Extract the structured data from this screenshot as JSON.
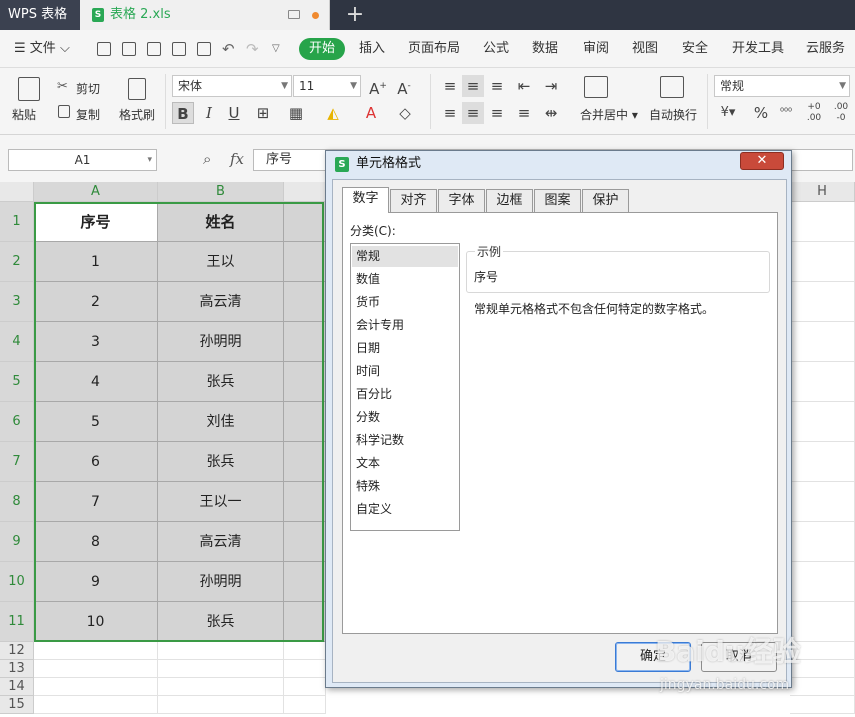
{
  "app": {
    "title": "WPS 表格",
    "doc_tab": "表格 2.xls",
    "xl_glyph": "S",
    "new_tab": "+"
  },
  "menu": {
    "file": "文件",
    "items": [
      "开始",
      "插入",
      "页面布局",
      "公式",
      "数据",
      "审阅",
      "视图",
      "安全",
      "开发工具",
      "云服务"
    ]
  },
  "ribbon": {
    "paste": "粘贴",
    "cut": "剪切",
    "copy": "复制",
    "format_painter": "格式刷",
    "font": "宋体",
    "size": "11",
    "bold": "B",
    "italic": "I",
    "underline": "U",
    "merge_center": "合并居中",
    "wrap_text": "自动换行",
    "number_format": "常规",
    "percent": "%"
  },
  "formula_bar": {
    "name_box": "A1",
    "fx": "fx",
    "content": "序号"
  },
  "grid": {
    "columns": [
      "A",
      "B",
      "H"
    ],
    "header_row": [
      "序号",
      "姓名"
    ],
    "rows": [
      [
        "1",
        "王以"
      ],
      [
        "2",
        "高云清"
      ],
      [
        "3",
        "孙明明"
      ],
      [
        "4",
        "张兵"
      ],
      [
        "5",
        "刘佳"
      ],
      [
        "6",
        "张兵"
      ],
      [
        "7",
        "王以一"
      ],
      [
        "8",
        "高云清"
      ],
      [
        "9",
        "孙明明"
      ],
      [
        "10",
        "张兵"
      ]
    ],
    "row_numbers": [
      "1",
      "2",
      "3",
      "4",
      "5",
      "6",
      "7",
      "8",
      "9",
      "10",
      "11",
      "12",
      "13",
      "14",
      "15"
    ]
  },
  "dialog": {
    "title": "单元格格式",
    "close": "✕",
    "tabs": [
      "数字",
      "对齐",
      "字体",
      "边框",
      "图案",
      "保护"
    ],
    "category_label": "分类(C):",
    "categories": [
      "常规",
      "数值",
      "货币",
      "会计专用",
      "日期",
      "时间",
      "百分比",
      "分数",
      "科学记数",
      "文本",
      "特殊",
      "自定义"
    ],
    "sample_legend": "示例",
    "sample_value": "序号",
    "description": "常规单元格格式不包含任何特定的数字格式。",
    "ok": "确定",
    "cancel": "取消"
  },
  "watermark": {
    "brand": "Baidu经验",
    "url": "jingyan.baidu.com"
  },
  "colors": {
    "accent": "#27a44a",
    "selection": "#3a9a45",
    "titlebar": "#2f3542"
  }
}
